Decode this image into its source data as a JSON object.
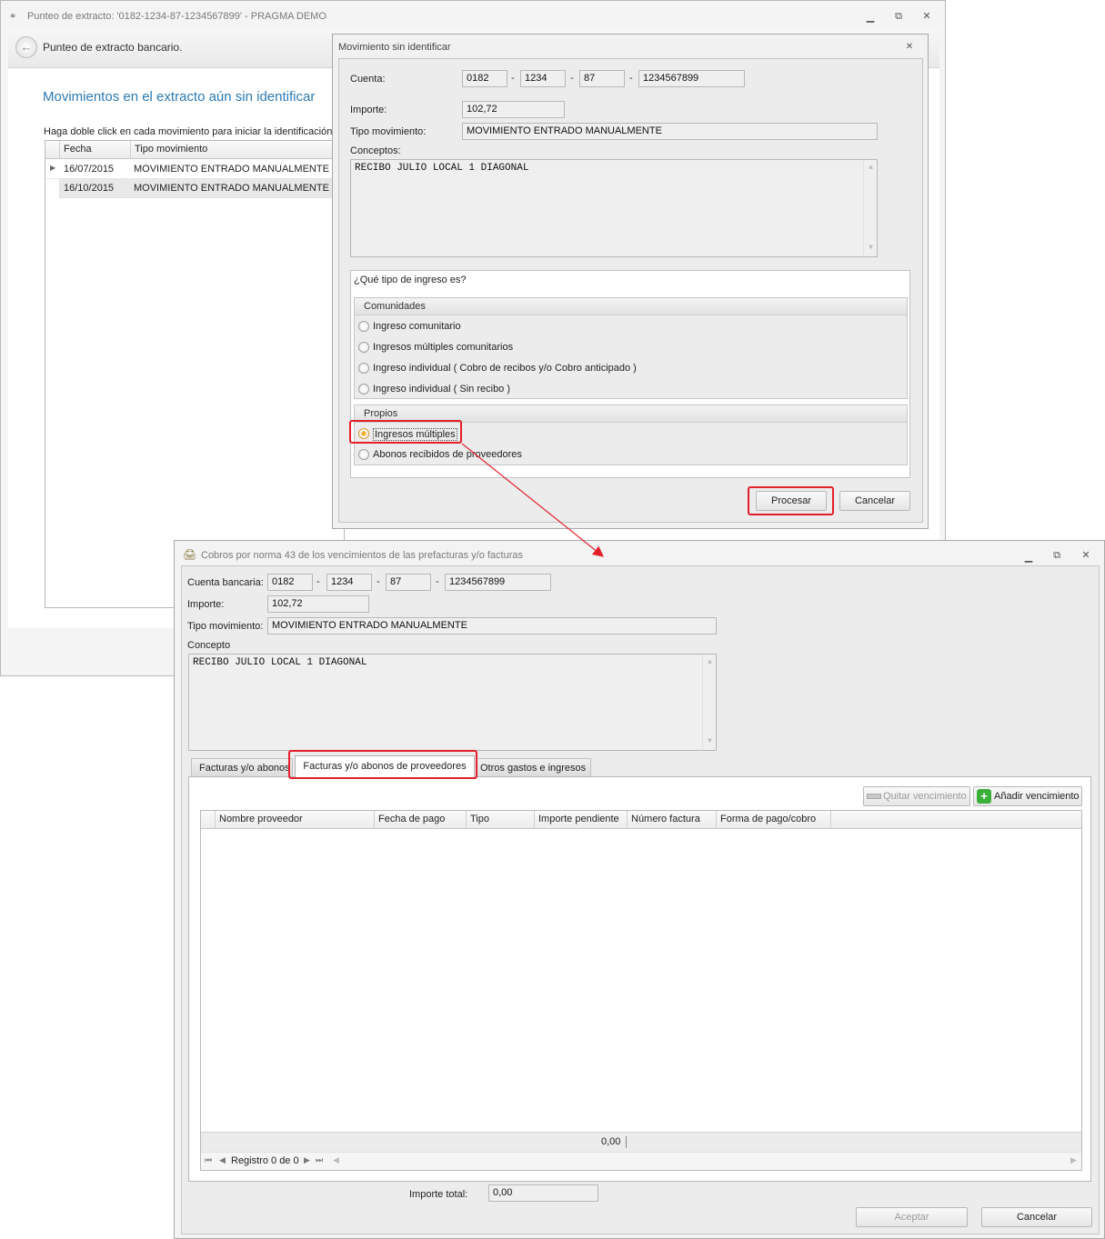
{
  "back_window": {
    "title": "Punteo de extracto: '0182-1234-87-1234567899' - PRAGMA DEMO",
    "header_title": "Punteo de extracto bancario.",
    "section_title": "Movimientos en el extracto aún sin identificar",
    "instruction": "Haga doble click en cada movimiento para iniciar la identificación ma",
    "columns": [
      "Fecha",
      "Tipo movimiento"
    ],
    "rows": [
      {
        "fecha": "16/07/2015",
        "tipo": "MOVIMIENTO ENTRADO MANUALMENTE"
      },
      {
        "fecha": "16/10/2015",
        "tipo": "MOVIMIENTO ENTRADO MANUALMENTE"
      }
    ]
  },
  "dialog": {
    "title": "Movimiento sin identificar",
    "cuenta_label": "Cuenta:",
    "cuenta": [
      "0182",
      "1234",
      "87",
      "1234567899"
    ],
    "importe_label": "Importe:",
    "importe": "102,72",
    "tipo_label": "Tipo movimiento:",
    "tipo": "MOVIMIENTO ENTRADO MANUALMENTE",
    "conceptos_label": "Conceptos:",
    "conceptos": "RECIBO JULIO LOCAL 1 DIAGONAL",
    "question": "¿Qué tipo de ingreso es?",
    "group_comunidades": "Comunidades",
    "options_comunidades": [
      "Ingreso comunitario",
      "Ingresos múltiples comunitarios",
      "Ingreso individual ( Cobro de recibos y/o Cobro anticipado )",
      "Ingreso individual ( Sin recibo )"
    ],
    "group_propios": "Propios",
    "options_propios": [
      "Ingresos múltiples",
      "Abonos recibidos de proveedores"
    ],
    "selected_option": "Ingresos múltiples",
    "procesar_label": "Procesar",
    "cancelar_label": "Cancelar"
  },
  "front_window": {
    "title": "Cobros por norma 43 de los vencimientos de las prefacturas y/o facturas",
    "cuenta_label": "Cuenta bancaria:",
    "cuenta": [
      "0182",
      "1234",
      "87",
      "1234567899"
    ],
    "importe_label": "Importe:",
    "importe": "102,72",
    "tipo_label": "Tipo movimiento:",
    "tipo": "MOVIMIENTO ENTRADO MANUALMENTE",
    "concepto_label": "Concepto",
    "concepto": "RECIBO JULIO LOCAL 1 DIAGONAL",
    "tabs": [
      "Facturas y/o abonos",
      "Facturas y/o abonos de proveedores",
      "Otros gastos e ingresos"
    ],
    "active_tab": "Facturas y/o abonos de proveedores",
    "quitar_label": "Quitar vencimiento",
    "anadir_label": "Añadir vencimiento",
    "columns": [
      "Nombre proveedor",
      "Fecha de pago",
      "Tipo",
      "Importe pendiente",
      "Número factura",
      "Forma de pago/cobro"
    ],
    "footer_sum": "0,00",
    "nav_record": "Registro 0 de 0",
    "importe_total_label": "Importe total:",
    "importe_total": "0,00",
    "aceptar_label": "Aceptar",
    "cancelar_label": "Cancelar"
  },
  "icons": {
    "minimize": "minimize-icon",
    "maximize": "maximize-icon",
    "close": "close-icon",
    "back": "back-arrow-icon",
    "add": "green-plus-icon",
    "remove": "minus-icon"
  },
  "colors": {
    "accent_title": "#2a7ab8",
    "highlight_red": "#e2202a",
    "radio_selected": "#f4b53d",
    "add_icon": "#3cae3a"
  }
}
